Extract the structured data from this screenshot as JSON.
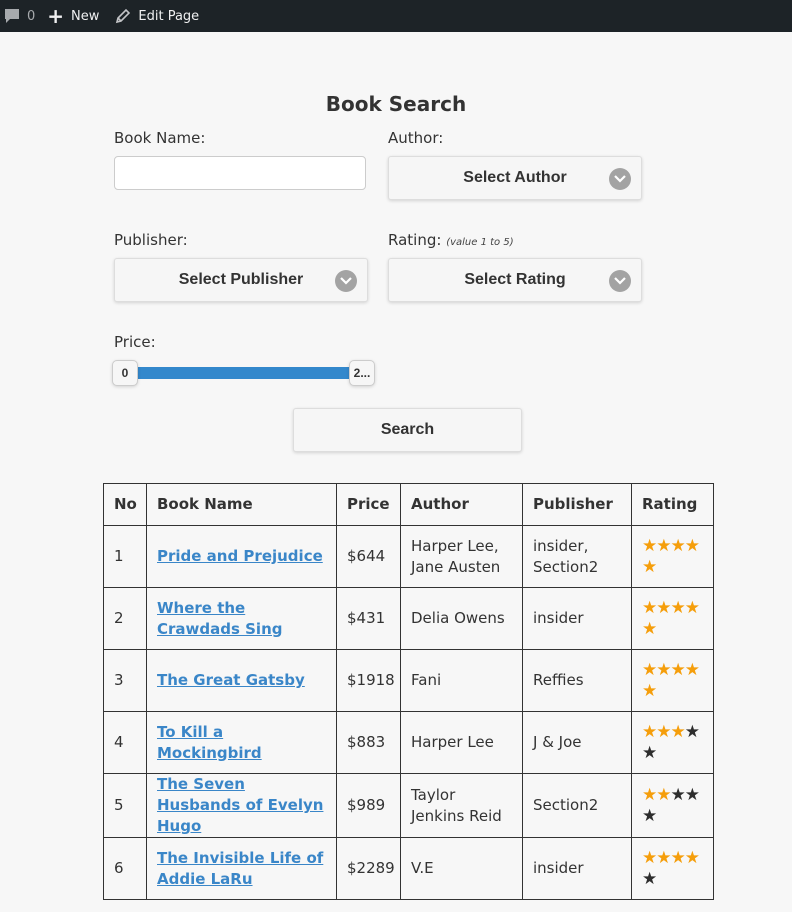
{
  "adminbar": {
    "comment_count": "0",
    "new_label": "New",
    "edit_label": "Edit Page"
  },
  "form": {
    "title": "Book Search",
    "book_name_label": "Book Name:",
    "book_name_value": "",
    "author_label": "Author:",
    "author_select": "Select Author",
    "publisher_label": "Publisher:",
    "publisher_select": "Select Publisher",
    "rating_label": "Rating:",
    "rating_hint": "(value 1 to 5)",
    "rating_select": "Select Rating",
    "price_label": "Price:",
    "price_min": "0",
    "price_max": "2...",
    "search_label": "Search"
  },
  "table": {
    "headers": [
      "No",
      "Book Name",
      "Price",
      "Author",
      "Publisher",
      "Rating"
    ],
    "rows": [
      {
        "no": "1",
        "name": "Pride and Prejudice",
        "price": "$644",
        "author": "Harper Lee, Jane Austen",
        "publisher": "insider, Section2",
        "rating": 5
      },
      {
        "no": "2",
        "name": "Where the Crawdads Sing",
        "price": "$431",
        "author": "Delia Owens",
        "publisher": "insider",
        "rating": 5
      },
      {
        "no": "3",
        "name": "The Great Gatsby",
        "price": "$1918",
        "author": "Fani",
        "publisher": "Reffies",
        "rating": 5
      },
      {
        "no": "4",
        "name": "To Kill a Mockingbird",
        "price": "$883",
        "author": "Harper Lee",
        "publisher": "J & Joe",
        "rating": 3
      },
      {
        "no": "5",
        "name": "The Seven Husbands of Evelyn Hugo",
        "price": "$989",
        "author": "Taylor Jenkins Reid",
        "publisher": "Section2",
        "rating": 2
      },
      {
        "no": "6",
        "name": "The Invisible Life of Addie LaRu",
        "price": "$2289",
        "author": "V.E",
        "publisher": "insider",
        "rating": 4
      }
    ]
  },
  "colors": {
    "accent": "#3388cc",
    "link": "#3a86c8",
    "star_filled": "#f59e0b",
    "star_empty": "#2d2d2d",
    "adminbar_bg": "#1d2327"
  }
}
